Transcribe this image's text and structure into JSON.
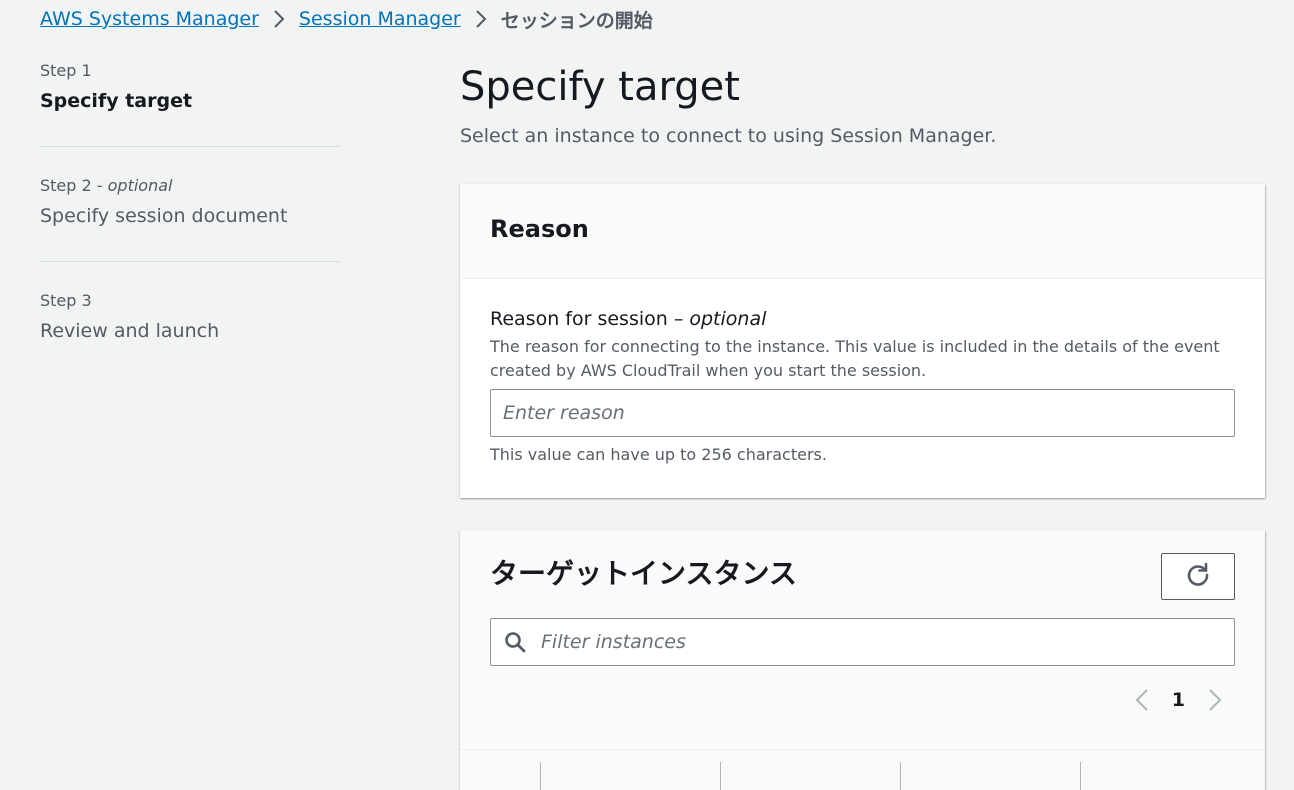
{
  "breadcrumb": {
    "items": [
      "AWS Systems Manager",
      "Session Manager"
    ],
    "current": "セッションの開始"
  },
  "steps": [
    {
      "num": "Step 1",
      "optional": "",
      "title": "Specify target"
    },
    {
      "num": "Step 2 - ",
      "optional": "optional",
      "title": "Specify session document"
    },
    {
      "num": "Step 3",
      "optional": "",
      "title": "Review and launch"
    }
  ],
  "page": {
    "title": "Specify target",
    "description": "Select an instance to connect to using Session Manager."
  },
  "reason": {
    "header": "Reason",
    "label": "Reason for session – ",
    "label_optional": "optional",
    "description": "The reason for connecting to the instance. This value is included in the details of the event created by AWS CloudTrail when you start the session.",
    "placeholder": "Enter reason",
    "constraint": "This value can have up to 256 characters."
  },
  "targets": {
    "header": "ターゲットインスタンス",
    "filter_placeholder": "Filter instances",
    "current_page": "1"
  },
  "colors": {
    "link": "#0073bb",
    "background": "#f2f3f3",
    "text": "#16191f",
    "secondary_text": "#545b64"
  },
  "icons": {
    "breadcrumb_separator": "chevron-right-icon",
    "refresh": "refresh-icon",
    "search": "search-icon",
    "prev_page": "chevron-left-icon",
    "next_page": "chevron-right-icon"
  }
}
